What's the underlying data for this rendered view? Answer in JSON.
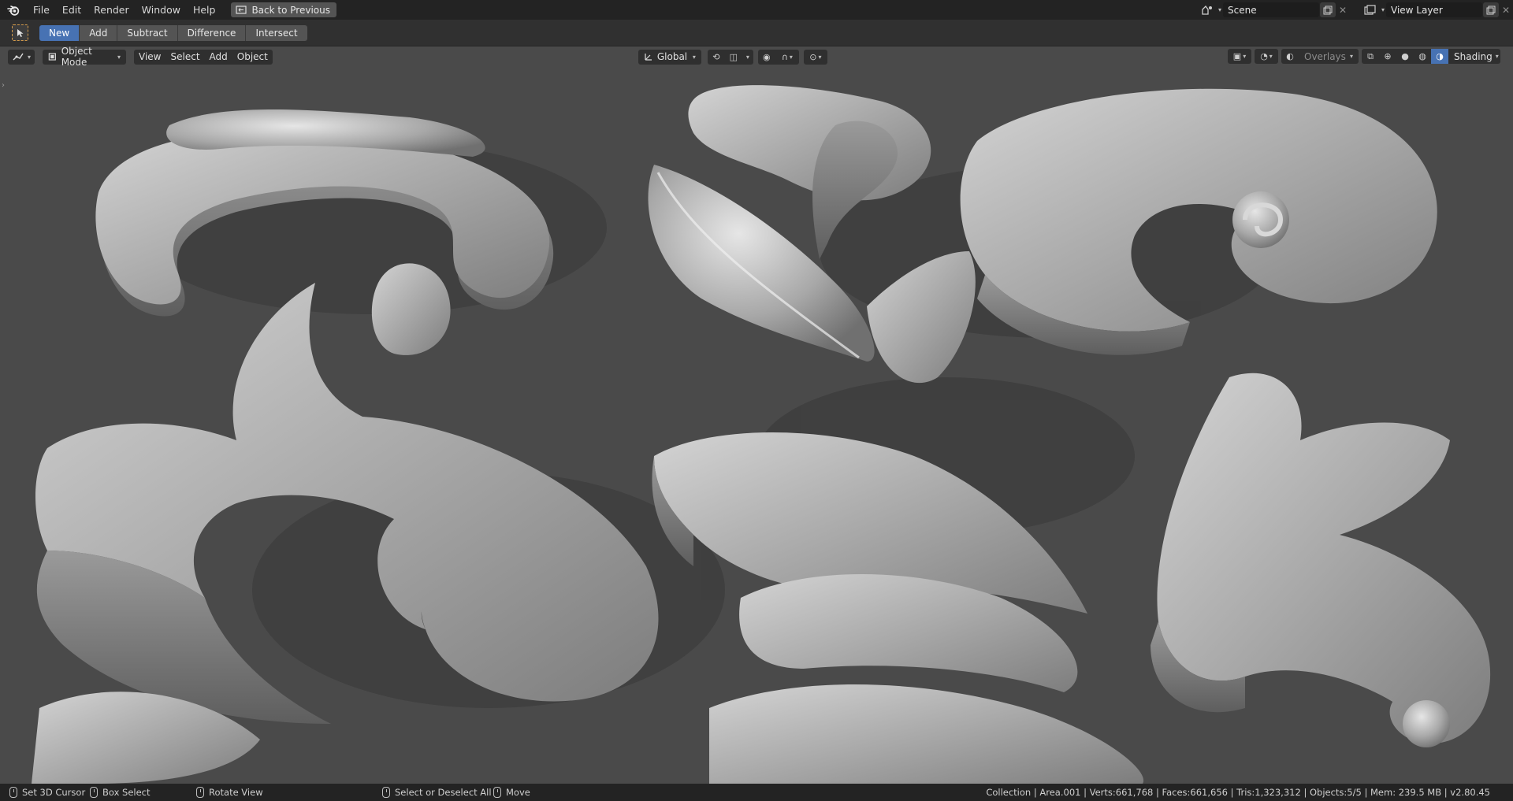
{
  "topbar": {
    "menu": [
      "File",
      "Edit",
      "Render",
      "Window",
      "Help"
    ],
    "back_label": "Back to Previous",
    "scene_value": "Scene",
    "view_layer_value": "View Layer"
  },
  "tool_header": {
    "modes": [
      "New",
      "Add",
      "Subtract",
      "Difference",
      "Intersect"
    ],
    "active_mode": "New"
  },
  "viewport_header": {
    "mode_label": "Object Mode",
    "menus": [
      "View",
      "Select",
      "Add",
      "Object"
    ],
    "orientation": "Global",
    "overlays_label": "Overlays",
    "shading_label": "Shading"
  },
  "statusbar": {
    "items": [
      "Set 3D Cursor",
      "Box Select",
      "Rotate View",
      "Select or Deselect All",
      "Move"
    ],
    "stats": "Collection | Area.001 | Verts:661,768 | Faces:661,656 | Tris:1,323,312 | Objects:5/5 | Mem: 239.5 MB | v2.80.45"
  },
  "colors": {
    "accent": "#4772b3",
    "viewport_bg": "#4b4b4b",
    "ui_bg": "#232323"
  }
}
